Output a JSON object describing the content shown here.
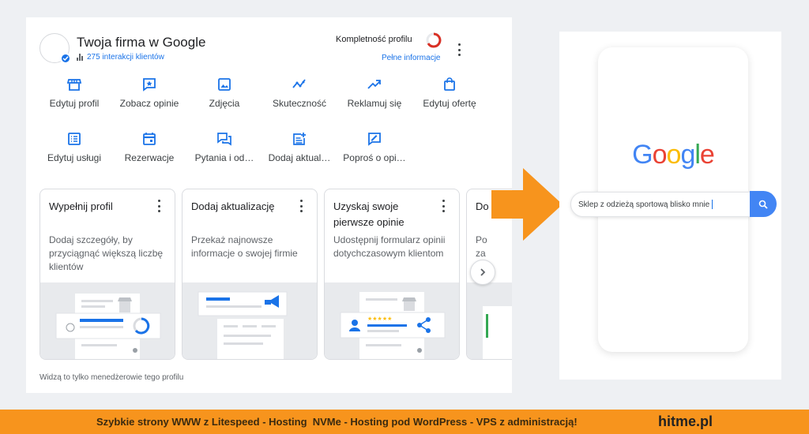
{
  "business": {
    "title": "Twoja firma w Google",
    "interactions": "275 interakcji klientów",
    "completeness_label": "Kompletność profilu",
    "full_info_link": "Pełne informacje"
  },
  "actions": [
    {
      "label": "Edytuj profil",
      "icon": "storefront-icon"
    },
    {
      "label": "Zobacz opinie",
      "icon": "star-review-icon"
    },
    {
      "label": "Zdjęcia",
      "icon": "photo-icon"
    },
    {
      "label": "Skuteczność",
      "icon": "performance-icon"
    },
    {
      "label": "Reklamuj się",
      "icon": "trending-up-icon"
    },
    {
      "label": "Edytuj ofertę",
      "icon": "shopping-bag-icon"
    },
    {
      "label": "Edytuj usługi",
      "icon": "list-icon"
    },
    {
      "label": "Rezerwacje",
      "icon": "calendar-icon"
    },
    {
      "label": "Pytania i od…",
      "icon": "questions-icon"
    },
    {
      "label": "Dodaj aktual…",
      "icon": "post-add-icon"
    },
    {
      "label": "Poproś o opi…",
      "icon": "rate-review-icon"
    }
  ],
  "cards": [
    {
      "title": "Wypełnij profil",
      "desc": "Dodaj szczegóły, by przyciągnąć większą liczbę klientów"
    },
    {
      "title": "Dodaj aktualizację",
      "desc": "Przekaż najnowsze informacje o swojej firmie"
    },
    {
      "title": "Uzyskaj swoje pierwsze opinie",
      "desc": "Udostępnij formularz opinii dotychczasowym klientom"
    },
    {
      "title": "Do ws",
      "desc": "Po za"
    }
  ],
  "footer_note": "Widzą to tylko menedżerowie tego profilu",
  "phone": {
    "logo": "Google",
    "search_query": "Sklep z odzieżą sportową blisko mnie"
  },
  "banner": {
    "text": "Szybkie strony WWW z Litespeed - Hosting  NVMe - Hosting pod WordPress - VPS z administracją!",
    "brand": "hitme.pl"
  },
  "colors": {
    "accent": "#1a73e8",
    "arrow": "#f7941d",
    "banner": "#f7941d",
    "google_blue": "#4285f4",
    "google_red": "#ea4335",
    "google_yellow": "#fbbc05",
    "google_green": "#34a853"
  }
}
